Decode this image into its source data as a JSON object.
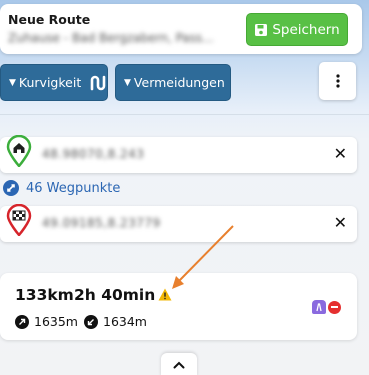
{
  "header": {
    "title": "Neue Route",
    "subtitle": "Zuhause - Bad Bergzabern, Pass...",
    "save_label": "Speichern"
  },
  "filters": {
    "curviness_label": "Kurvigkeit",
    "avoid_label": "Vermeidungen"
  },
  "waypoints": {
    "start_coords": "48.98070,8.243",
    "waypoint_count_label": "46 Wegpunkte",
    "end_coords": "49.09185,8.23779"
  },
  "summary": {
    "distance": "133km",
    "duration": "2h 40min",
    "ascent": "1635m",
    "descent": "1634m"
  },
  "colors": {
    "save_green": "#58c045",
    "filter_blue": "#2e6b99",
    "link_blue": "#2b66b3",
    "start_pin_green": "#3cae3c",
    "end_pin_red": "#d6242b",
    "warning_yellow": "#f2b705",
    "annotation_orange": "#e8802e"
  },
  "icons": {
    "save": "floppy-disk-icon",
    "curviness": "squiggle-icon",
    "more": "vertical-ellipsis-icon",
    "start": "home-pin-icon",
    "end": "finish-flag-pin-icon",
    "waypoints": "route-link-icon",
    "warning": "warning-triangle-icon",
    "ascent": "arrow-up-right-icon",
    "descent": "arrow-down-left-icon",
    "expand": "chevron-up-icon"
  }
}
